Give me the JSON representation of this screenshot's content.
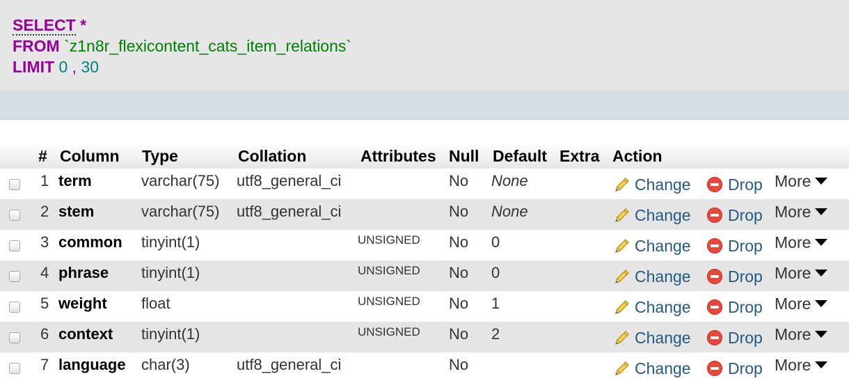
{
  "sql": {
    "select_kw": "SELECT",
    "star": "*",
    "from_kw": "FROM",
    "table": "`z1n8r_flexicontent_cats_item_relations`",
    "limit_kw": "LIMIT",
    "limit_start": "0",
    "limit_sep": ",",
    "limit_count": "30"
  },
  "table": {
    "headers": {
      "num": "#",
      "column": "Column",
      "type": "Type",
      "collation": "Collation",
      "attributes": "Attributes",
      "null": "Null",
      "default": "Default",
      "extra": "Extra",
      "action": "Action"
    },
    "actions": {
      "change": "Change",
      "drop": "Drop",
      "more": "More"
    },
    "rows": [
      {
        "num": "1",
        "name": "term",
        "type": "varchar(75)",
        "collation": "utf8_general_ci",
        "attributes": "",
        "null": "No",
        "default": "None"
      },
      {
        "num": "2",
        "name": "stem",
        "type": "varchar(75)",
        "collation": "utf8_general_ci",
        "attributes": "",
        "null": "No",
        "default": "None"
      },
      {
        "num": "3",
        "name": "common",
        "type": "tinyint(1)",
        "collation": "",
        "attributes": "UNSIGNED",
        "null": "No",
        "default": "0"
      },
      {
        "num": "4",
        "name": "phrase",
        "type": "tinyint(1)",
        "collation": "",
        "attributes": "UNSIGNED",
        "null": "No",
        "default": "0"
      },
      {
        "num": "5",
        "name": "weight",
        "type": "float",
        "collation": "",
        "attributes": "UNSIGNED",
        "null": "No",
        "default": "1"
      },
      {
        "num": "6",
        "name": "context",
        "type": "tinyint(1)",
        "collation": "",
        "attributes": "UNSIGNED",
        "null": "No",
        "default": "2"
      },
      {
        "num": "7",
        "name": "language",
        "type": "char(3)",
        "collation": "utf8_general_ci",
        "attributes": "",
        "null": "No",
        "default": ""
      }
    ]
  },
  "colors": {
    "keyword": "#990099",
    "table_name": "#008000",
    "number": "#008080",
    "link": "#235a81",
    "drop_icon": "#e8483c",
    "row_alt": "#e5e5e5"
  },
  "icons": {
    "change": "pencil-icon",
    "drop": "drop-circle-icon",
    "more": "caret-down-icon"
  }
}
